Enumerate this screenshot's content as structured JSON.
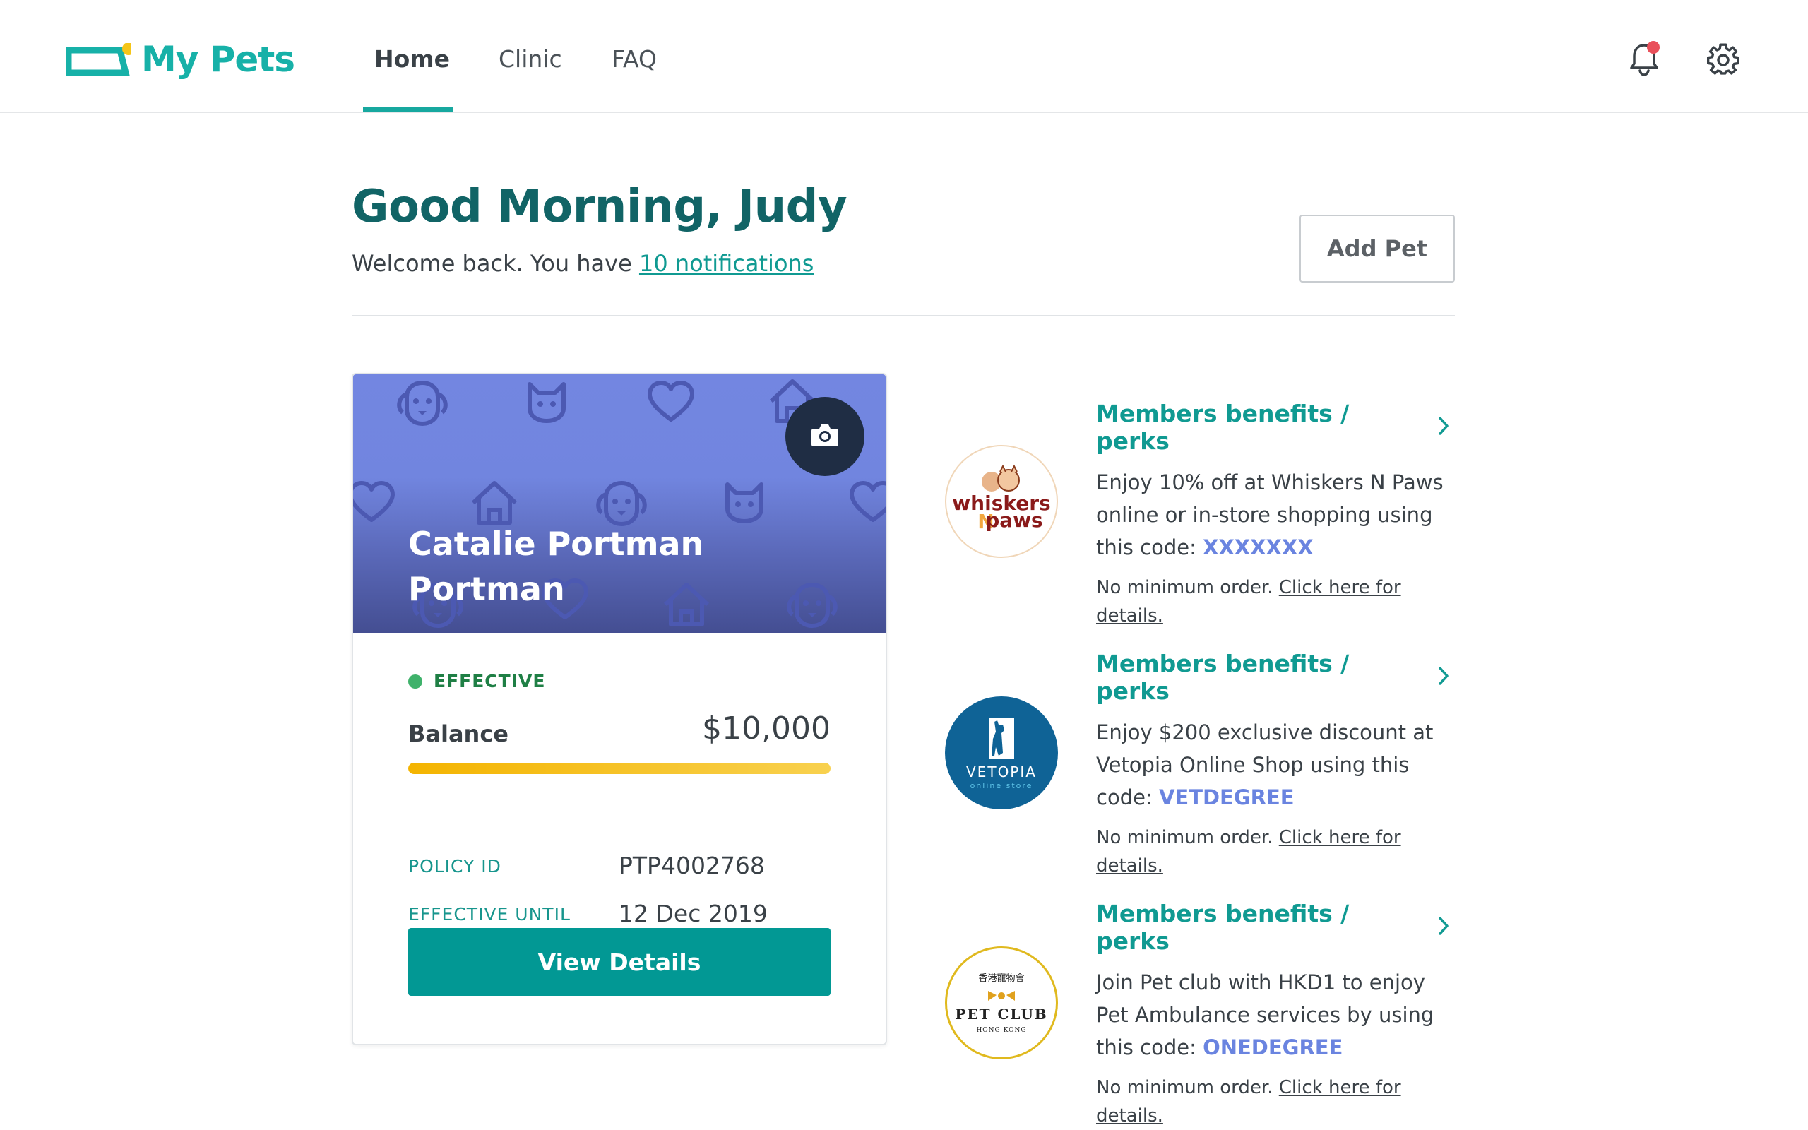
{
  "header": {
    "logo_text": "My Pets",
    "nav": [
      {
        "label": "Home",
        "active": true
      },
      {
        "label": "Clinic",
        "active": false
      },
      {
        "label": "FAQ",
        "active": false
      }
    ],
    "icons": [
      "bell-icon",
      "gear-icon"
    ],
    "has_unread_notifications": true
  },
  "greeting": {
    "title": "Good Morning, Judy",
    "welcome_prefix": "Welcome back. You have ",
    "notifications_link": "10 notifications",
    "add_pet_label": "Add Pet"
  },
  "pet_card": {
    "name": "Catalie Portman Portman",
    "status": "EFFECTIVE",
    "balance_label": "Balance",
    "balance_value": "$10,000",
    "balance_fill_fraction": 1.0,
    "policy_id_label": "POLICY ID",
    "policy_id_value": "PTP4002768",
    "effective_until_label": "EFFECTIVE UNTIL",
    "effective_until_value": "12 Dec 2019",
    "view_details_label": "View Details"
  },
  "perks": [
    {
      "title": "Members benefits / perks",
      "desc_prefix": "Enjoy 10% off at Whiskers N Paws online or in-store shopping using this code: ",
      "code": "XXXXXXX",
      "note_prefix": "No minimum order. ",
      "note_link": "Click here for details.",
      "logo": {
        "line1": "whiskers",
        "line2": "paws",
        "letter": "N"
      }
    },
    {
      "title": "Members benefits / perks",
      "desc_prefix": "Enjoy $200 exclusive discount at Vetopia Online Shop using this code: ",
      "code": "VETDEGREE",
      "note_prefix": "No minimum order. ",
      "note_link": "Click here for details.",
      "logo": {
        "line1": "VETOPIA",
        "line2": "online store"
      }
    },
    {
      "title": "Members benefits / perks",
      "desc_prefix": "Join Pet club with HKD1 to enjoy Pet Ambulance services by using this code: ",
      "code": "ONEDEGREE",
      "note_prefix": "No minimum order. ",
      "note_link": "Click here for details.",
      "logo": {
        "line0": "香港寵物會",
        "line1": "PET CLUB",
        "line2": "HONG KONG"
      }
    }
  ],
  "colors": {
    "brand": "#17b1a8",
    "heading": "#116466",
    "primary_button": "#029894",
    "card_banner": "#7386e1",
    "code_highlight": "#6a84e0",
    "status_green": "#3fb26b",
    "balance_bar": "#f4b400"
  }
}
